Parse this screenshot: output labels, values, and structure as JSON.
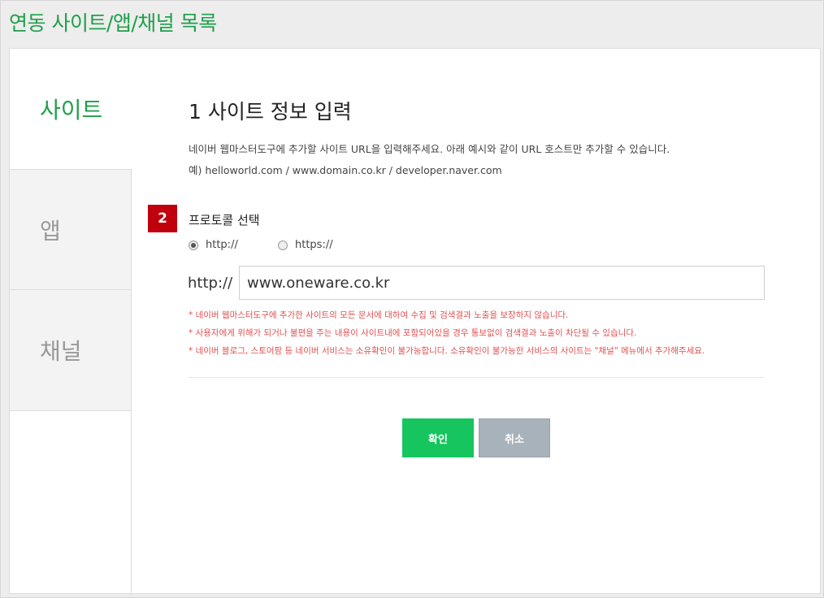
{
  "page": {
    "title": "연동 사이트/앱/채널 목록"
  },
  "sidebar": {
    "items": [
      {
        "label": "사이트",
        "active": true
      },
      {
        "label": "앱",
        "active": false
      },
      {
        "label": "채널",
        "active": false
      }
    ]
  },
  "main": {
    "section_title": "1 사이트 정보 입력",
    "description_line1": "네이버 웹마스터도구에 추가할 사이트 URL을 입력해주세요. 아래 예시와 같이 URL 호스트만 추가할 수 있습니다.",
    "description_line2": "예) helloworld.com / www.domain.co.kr / developer.naver.com",
    "step_badge": "2",
    "protocol_label": "프로토콜 선택",
    "protocol_options": [
      {
        "label": "http://",
        "checked": true
      },
      {
        "label": "https://",
        "checked": false
      }
    ],
    "url_prefix": "http://",
    "url_value": "www.oneware.co.kr",
    "notices": [
      "* 네이버 웹마스터도구에 추가한 사이트의 모든 문서에 대하여 수집 및 검색결과 노출을 보장하지 않습니다.",
      "* 사용자에게 위해가 되거나 불편을 주는 내용이 사이트내에 포함되어있을 경우 통보없이 검색결과 노출이 차단될 수 있습니다.",
      "* 네이버 블로그, 스토어팜 등 네이버 서비스는 소유확인이 불가능합니다. 소유확인이 불가능한 서비스의 사이트는 \"채널\" 메뉴에서 추가해주세요."
    ],
    "buttons": {
      "confirm": "확인",
      "cancel": "취소"
    }
  },
  "colors": {
    "brand_green": "#1fa04a",
    "button_green": "#16c55d",
    "badge_red": "#c0000c",
    "notice_red": "#e05050",
    "cancel_gray": "#a8b2bb"
  }
}
